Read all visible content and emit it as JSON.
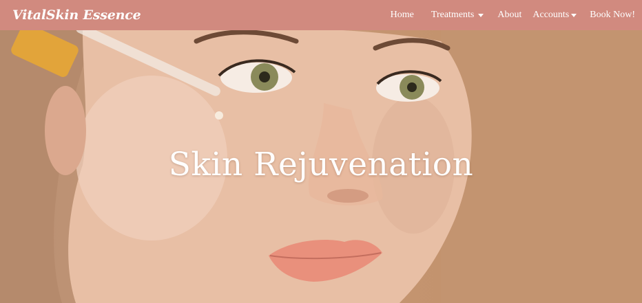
{
  "navbar": {
    "brand": "VitalSkin Essence",
    "links": {
      "home": "Home",
      "treatments": "Treatments",
      "about": "About",
      "accounts": "Accounts",
      "book": "Book Now!"
    },
    "background_color": "#d18a7f"
  },
  "hero": {
    "title": "Skin Rejuvenation",
    "background_color": "#c2956c"
  }
}
